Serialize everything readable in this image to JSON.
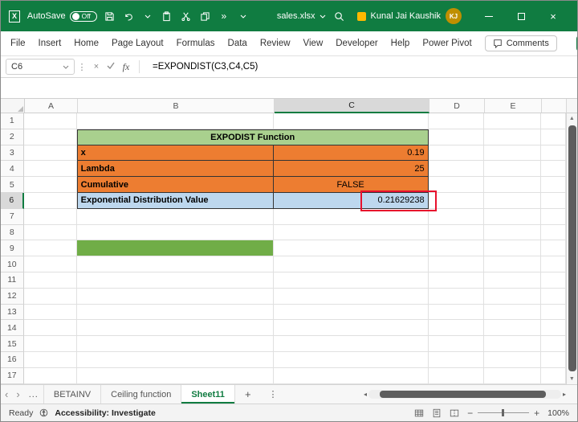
{
  "titlebar": {
    "autosave_label": "AutoSave",
    "autosave_state": "Off",
    "filename": "sales.xlsx",
    "user_name": "Kunal Jai Kaushik",
    "user_initials": "KJ"
  },
  "menubar": {
    "items": [
      "File",
      "Insert",
      "Home",
      "Page Layout",
      "Formulas",
      "Data",
      "Review",
      "View",
      "Developer",
      "Help",
      "Power Pivot"
    ],
    "comments_label": "Comments"
  },
  "formula_bar": {
    "name_box": "C6",
    "fx_label": "fx",
    "formula": "=EXPONDIST(C3,C4,C5)"
  },
  "grid": {
    "column_headers": [
      "A",
      "B",
      "C",
      "D",
      "E",
      ""
    ],
    "row_count": 17,
    "selected_column_index": 2,
    "selected_row": 6,
    "cells": [
      {
        "row": 2,
        "col": 1,
        "span": 2,
        "text": "EXPODIST Function",
        "style": "title"
      },
      {
        "row": 3,
        "col": 1,
        "text": "x",
        "style": "label"
      },
      {
        "row": 3,
        "col": 2,
        "text": "0.19",
        "style": "value-right"
      },
      {
        "row": 4,
        "col": 1,
        "text": "Lambda",
        "style": "label"
      },
      {
        "row": 4,
        "col": 2,
        "text": "25",
        "style": "value-right"
      },
      {
        "row": 5,
        "col": 1,
        "text": "Cumulative",
        "style": "label"
      },
      {
        "row": 5,
        "col": 2,
        "text": "FALSE",
        "style": "value-center"
      },
      {
        "row": 6,
        "col": 1,
        "text": "Exponential Distribution Value",
        "style": "result-label"
      },
      {
        "row": 6,
        "col": 2,
        "text": "0.21629238",
        "style": "result-value"
      },
      {
        "row": 9,
        "col": 1,
        "text": "",
        "style": "green-fill"
      }
    ]
  },
  "sheet_tabs": {
    "ellipsis": "...",
    "tabs": [
      {
        "label": "BETAINV",
        "active": false
      },
      {
        "label": "Ceiling function",
        "active": false
      },
      {
        "label": "Sheet11",
        "active": true
      }
    ],
    "add_label": "+"
  },
  "status_bar": {
    "ready_label": "Ready",
    "accessibility_label": "Accessibility: Investigate",
    "zoom_level": "100%"
  },
  "icons": {
    "overflow": "»",
    "kebab": "⋮",
    "nav_left": "‹",
    "nav_right": "›",
    "scroll_left": "◂",
    "scroll_right": "▸",
    "scroll_up": "▲",
    "scroll_down": "▼",
    "close": "×",
    "minus": "−",
    "plus": "+"
  },
  "colors": {
    "titlebar_green": "#107C41",
    "table_header_green": "#A9D08E",
    "row_orange": "#ED7D31",
    "row_blue": "#BDD7EE",
    "fill_green": "#70AD47",
    "annotation_red": "#E8112D"
  }
}
